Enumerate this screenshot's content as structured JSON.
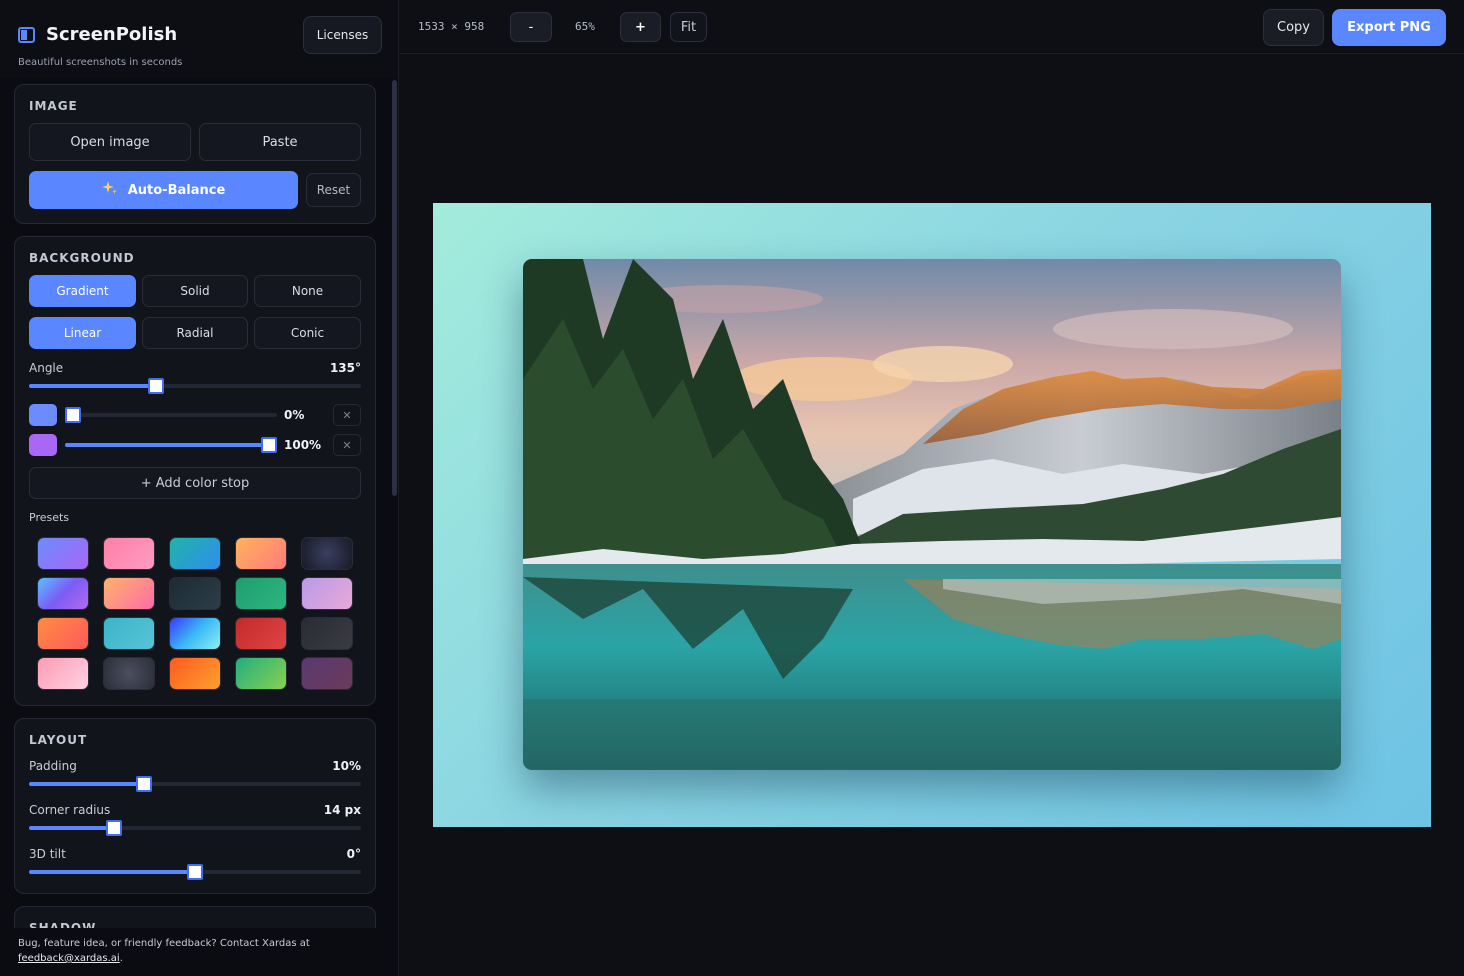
{
  "app": {
    "name": "ScreenPolish",
    "tagline": "Beautiful screenshots in seconds",
    "licenses_label": "Licenses"
  },
  "image_panel": {
    "title": "IMAGE",
    "open_label": "Open image",
    "paste_label": "Paste",
    "auto_balance_label": "Auto-Balance",
    "reset_label": "Reset"
  },
  "background_panel": {
    "title": "BACKGROUND",
    "modes": [
      "Gradient",
      "Solid",
      "None"
    ],
    "active_mode": "Gradient",
    "gradient_types": [
      "Linear",
      "Radial",
      "Conic"
    ],
    "active_gradient_type": "Linear",
    "angle_label": "Angle",
    "angle_value": "135°",
    "angle_fraction": 0.375,
    "stops": [
      {
        "color": "#6b8bff",
        "position": "0%",
        "fraction": 0.0
      },
      {
        "color": "#a868f5",
        "position": "100%",
        "fraction": 1.0
      }
    ],
    "add_stop_label": "+ Add color stop",
    "presets_label": "Presets",
    "presets": [
      "linear-gradient(135deg,#6b8bff,#a868f5)",
      "linear-gradient(135deg,#ff7fa8,#ff9bc1)",
      "linear-gradient(135deg,#1fb5a5,#2f8df0)",
      "linear-gradient(135deg,#ffb35c,#ff7a7a)",
      "radial-gradient(circle,#3a3f60,#181a26)",
      "linear-gradient(135deg,#5ac0ff,#7b5cf5,#b36bf0)",
      "linear-gradient(135deg,#ffb36b,#ff6ba6)",
      "linear-gradient(135deg,#1c2a33,#2c3e48)",
      "linear-gradient(135deg,#1f9e6e,#2db67f)",
      "linear-gradient(135deg,#b89ae8,#e9a9d8)",
      "linear-gradient(135deg,#ff8c42,#ff5a5a)",
      "linear-gradient(135deg,#3bb4c8,#58c4d8)",
      "linear-gradient(135deg,#3a3af5,#3bb8f5,#8ef0f0)",
      "linear-gradient(135deg,#c42a2a,#e04545)",
      "linear-gradient(135deg,#2a2c33,#3a3c44)",
      "linear-gradient(135deg,#ff9cb3,#ffd1e3)",
      "radial-gradient(circle,#4a5060,#2a2e38)",
      "linear-gradient(135deg,#ff5a1f,#ffa030)",
      "linear-gradient(135deg,#1faf7f,#8bd050)",
      "linear-gradient(135deg,#5a3a70,#6a3a5a)"
    ]
  },
  "layout_panel": {
    "title": "LAYOUT",
    "padding_label": "Padding",
    "padding_value": "10%",
    "padding_fraction": 0.34,
    "radius_label": "Corner radius",
    "radius_value": "14 px",
    "radius_fraction": 0.245,
    "tilt_label": "3D tilt",
    "tilt_value": "0°",
    "tilt_fraction": 0.5
  },
  "shadow_panel": {
    "title": "SHADOW"
  },
  "footer": {
    "text": "Bug, feature idea, or friendly feedback? Contact Xardas at",
    "email": "feedback@xardas.ai",
    "suffix": "."
  },
  "toolbar": {
    "dimensions": "1533 × 958",
    "zoom_out_label": "-",
    "zoom_level": "65%",
    "zoom_in_label": "+",
    "fit_label": "Fit",
    "copy_label": "Copy",
    "export_label": "Export PNG"
  },
  "colors": {
    "accent": "#5a86ff",
    "canvas_gradient": "linear-gradient(135deg, #a3ecdc, #6ec3e4)"
  }
}
